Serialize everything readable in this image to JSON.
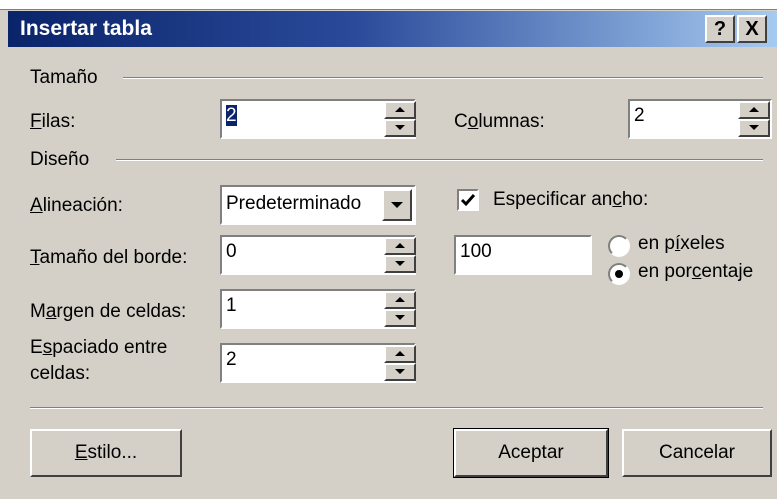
{
  "dialog": {
    "title": "Insertar tabla",
    "help_button": "?",
    "close_button": "X"
  },
  "size_group": {
    "label": "Tamaño",
    "rows_label": {
      "mnemonic": "F",
      "rest": "ilas:"
    },
    "rows_value": "2",
    "columns_label": {
      "pre": "C",
      "mnemonic": "o",
      "rest": "lumnas:"
    },
    "columns_value": "2"
  },
  "design_group": {
    "label": "Diseño",
    "alignment_label": {
      "mnemonic": "A",
      "rest": "lineación:"
    },
    "alignment_value": "Predeterminado",
    "border_label": {
      "mnemonic": "T",
      "rest": "amaño del borde:"
    },
    "border_value": "0",
    "padding_label": {
      "pre": "M",
      "mnemonic": "a",
      "rest": "rgen de celdas:"
    },
    "padding_value": "1",
    "spacing_label": {
      "pre": "E",
      "mnemonic": "s",
      "rest": "paciado entre",
      "line2": "celdas:"
    },
    "spacing_value": "2",
    "specify_width_checked": true,
    "specify_width_label": {
      "pre": "Especificar an",
      "mnemonic": "c",
      "rest": "ho:"
    },
    "width_value": "100",
    "pixels_label": {
      "pre": "en p",
      "mnemonic": "í",
      "rest": "xeles"
    },
    "percent_label": {
      "pre": "en por",
      "mnemonic": "c",
      "rest": "entaje"
    },
    "unit_selected": "percent"
  },
  "buttons": {
    "style": {
      "mnemonic": "E",
      "rest": "stilo..."
    },
    "ok": "Aceptar",
    "cancel": "Cancelar"
  }
}
